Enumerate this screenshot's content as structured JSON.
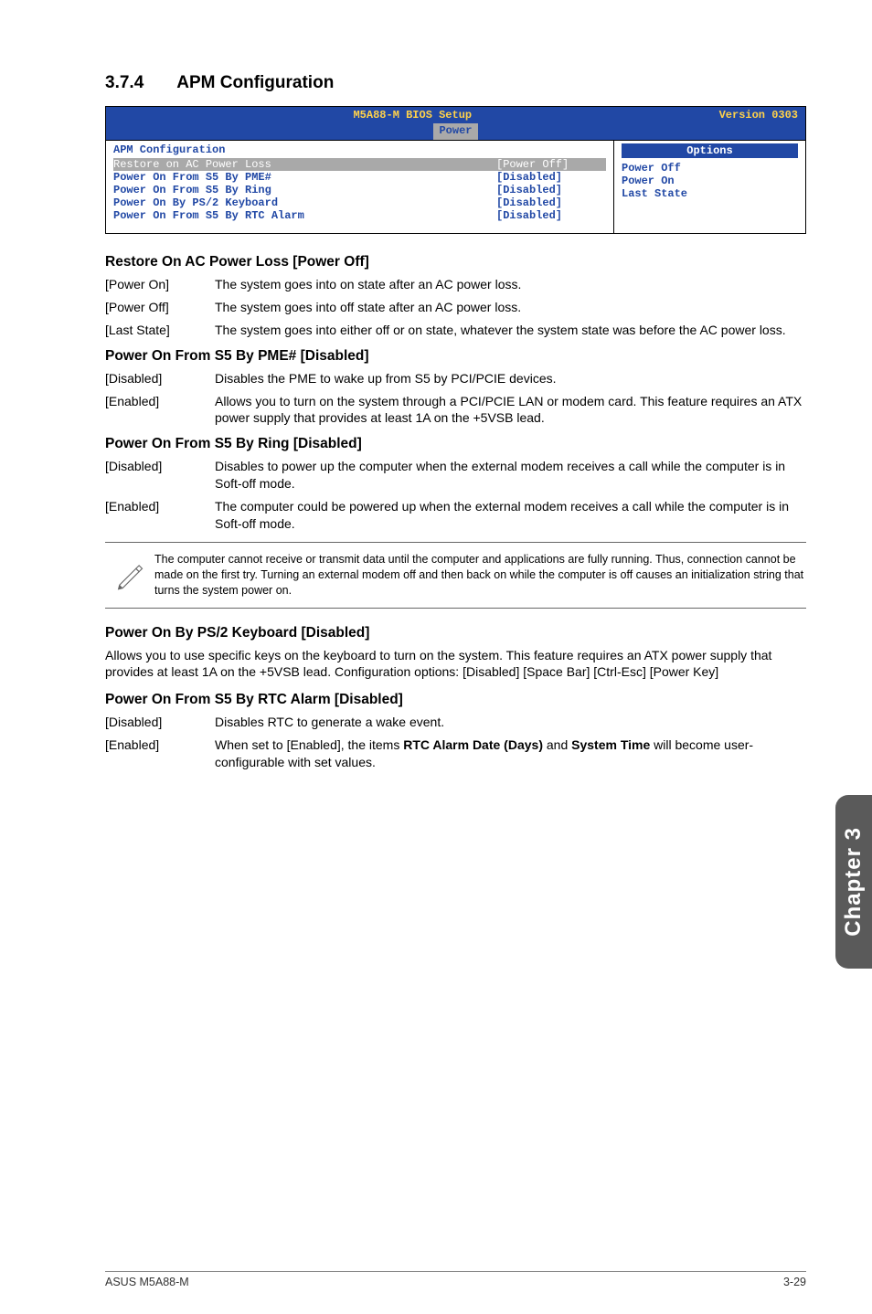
{
  "section": {
    "number": "3.7.4",
    "title": "APM Configuration"
  },
  "bios": {
    "setup_title": "M5A88-M BIOS Setup",
    "version": "Version 0303",
    "menu_tab": "Power",
    "panel_title": "APM Configuration",
    "rows": [
      {
        "key": "Restore on AC Power Loss",
        "value": "[Power Off]",
        "selected": true
      },
      {
        "key": "Power On From S5 By PME#",
        "value": "[Disabled]",
        "selected": false
      },
      {
        "key": "Power On From S5 By Ring",
        "value": "[Disabled]",
        "selected": false
      },
      {
        "key": "Power On By PS/2 Keyboard",
        "value": "[Disabled]",
        "selected": false
      },
      {
        "key": "Power On From S5 By RTC Alarm",
        "value": "[Disabled]",
        "selected": false
      }
    ],
    "options_header": "Options",
    "options": [
      "Power Off",
      "Power On",
      "Last State"
    ]
  },
  "restore": {
    "heading": "Restore On AC Power Loss [Power Off]",
    "rows": [
      {
        "k": "[Power On]",
        "v": "The system goes into on state after an AC power loss."
      },
      {
        "k": "[Power Off]",
        "v": "The system goes into off state after an AC power loss."
      },
      {
        "k": "[Last State]",
        "v": "The system goes into either off or on state, whatever the system state was before the AC power loss."
      }
    ]
  },
  "pme": {
    "heading": "Power On From S5 By PME# [Disabled]",
    "rows": [
      {
        "k": "[Disabled]",
        "v": "Disables the PME to wake up from S5 by PCI/PCIE devices."
      },
      {
        "k": "[Enabled]",
        "v": "Allows you to turn on the system through a PCI/PCIE LAN or modem card. This feature requires an ATX power supply that provides at least 1A on the +5VSB lead."
      }
    ]
  },
  "ring": {
    "heading": "Power On From S5 By Ring [Disabled]",
    "rows": [
      {
        "k": "[Disabled]",
        "v": "Disables to power up the computer when the external modem receives a call while the computer is in Soft-off mode."
      },
      {
        "k": "[Enabled]",
        "v": "The computer could be powered up when the external modem receives a call while the computer is in Soft-off mode."
      }
    ]
  },
  "note": {
    "text": "The computer cannot receive or transmit data until the computer and applications are fully running. Thus, connection cannot be made on the first try. Turning an external modem off and then back on while the computer is off causes an initialization string that turns the system power on."
  },
  "ps2": {
    "heading": "Power On By PS/2 Keyboard [Disabled]",
    "para": "Allows you to use specific keys on the keyboard to turn on the system. This feature requires an ATX power supply that provides at least 1A on the +5VSB lead. Configuration options: [Disabled] [Space Bar] [Ctrl-Esc] [Power Key]"
  },
  "rtc": {
    "heading": "Power On From S5 By RTC Alarm [Disabled]",
    "rows": [
      {
        "k": "[Disabled]",
        "v": "Disables RTC to generate a wake event."
      },
      {
        "k": "[Enabled]",
        "v_prefix": "When set to [Enabled], the items ",
        "v_bold1": "RTC Alarm Date (Days)",
        "v_mid": " and ",
        "v_bold2": "System Time",
        "v_suffix": " will become user-configurable with set values."
      }
    ]
  },
  "sidetab": "Chapter 3",
  "footer": {
    "left": "ASUS M5A88-M",
    "right": "3-29"
  }
}
